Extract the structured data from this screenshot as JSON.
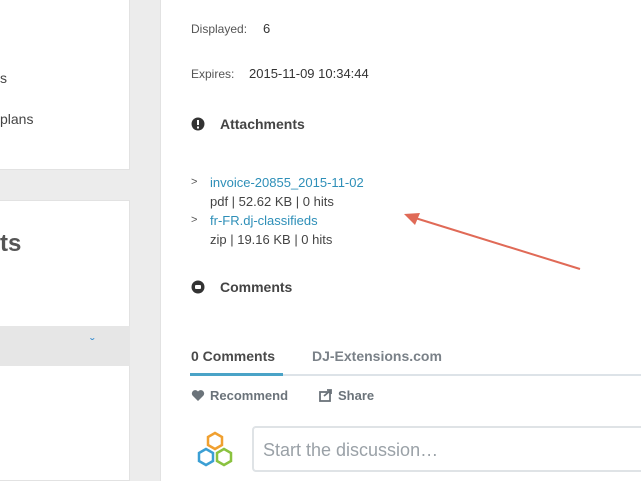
{
  "sidebar": {
    "item1_fragment": "s",
    "item2_fragment": "plans",
    "section_fragment": "ts",
    "select_chevron": "ˇ"
  },
  "details": {
    "displayed_label": "Displayed:",
    "displayed_value": "6",
    "expires_label": "Expires:",
    "expires_value": "2015-11-09 10:34:44"
  },
  "attachments": {
    "title": "Attachments",
    "files": [
      {
        "name": "invoice-20855_2015-11-02",
        "meta": "pdf | 52.62 KB | 0 hits"
      },
      {
        "name": "fr-FR.dj-classifieds",
        "meta": "zip | 19.16 KB | 0 hits"
      }
    ]
  },
  "comments": {
    "title": "Comments",
    "tab_count": "0 Comments",
    "tab_site": "DJ-Extensions.com",
    "recommend": "Recommend",
    "share": "Share",
    "placeholder": "Start the discussion…"
  },
  "colors": {
    "link": "#2e8fb8",
    "arrow": "#e06a57",
    "tab_underline": "#4aa3c7"
  }
}
